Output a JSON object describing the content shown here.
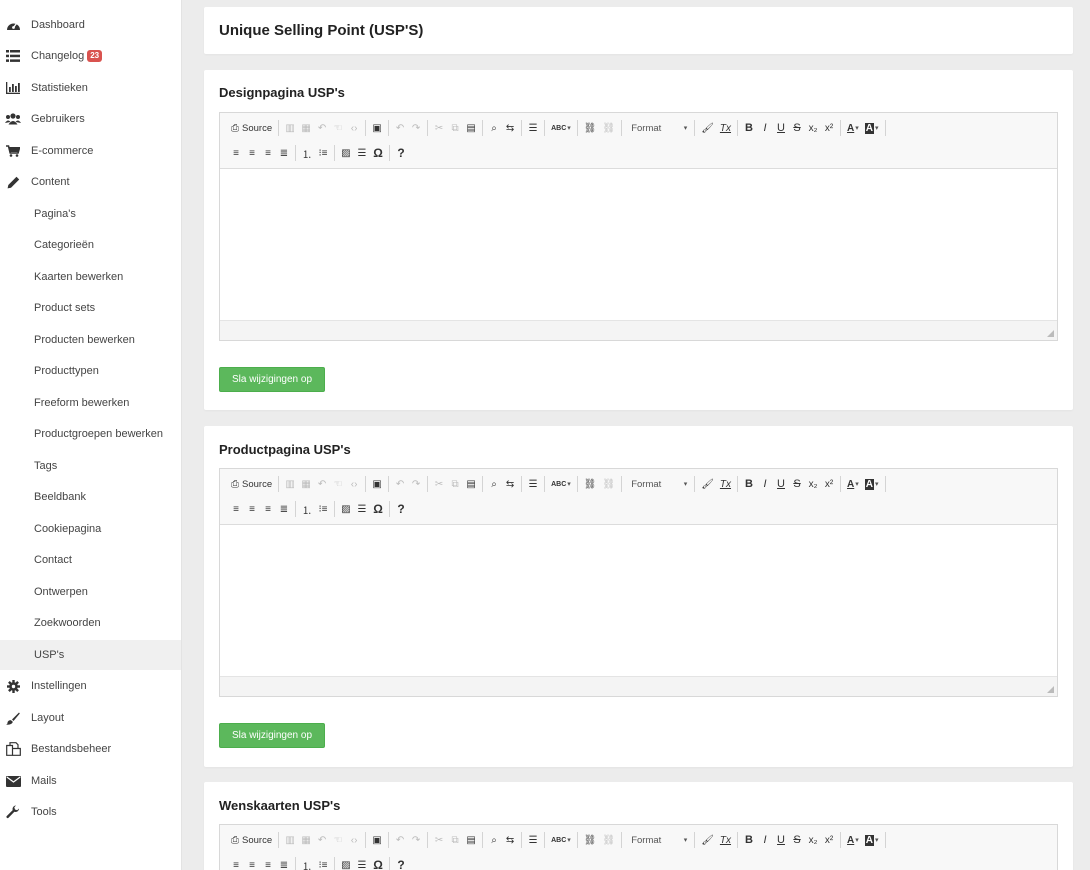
{
  "sidebar": {
    "items": [
      {
        "label": "Dashboard",
        "icon": "dashboard-icon"
      },
      {
        "label": "Changelog",
        "icon": "list-icon",
        "badge": "23"
      },
      {
        "label": "Statistieken",
        "icon": "bar-chart-icon"
      },
      {
        "label": "Gebruikers",
        "icon": "users-icon"
      },
      {
        "label": "E-commerce",
        "icon": "cart-icon"
      },
      {
        "label": "Content",
        "icon": "pencil-icon"
      },
      {
        "label": "Pagina's"
      },
      {
        "label": "Categorieën"
      },
      {
        "label": "Kaarten bewerken"
      },
      {
        "label": "Product sets"
      },
      {
        "label": "Producten bewerken"
      },
      {
        "label": "Producttypen"
      },
      {
        "label": "Freeform bewerken"
      },
      {
        "label": "Productgroepen bewerken"
      },
      {
        "label": "Tags"
      },
      {
        "label": "Beeldbank"
      },
      {
        "label": "Cookiepagina"
      },
      {
        "label": "Contact"
      },
      {
        "label": "Ontwerpen"
      },
      {
        "label": "Zoekwoorden"
      },
      {
        "label": "USP's",
        "active": true
      },
      {
        "label": "Instellingen",
        "icon": "gear-icon"
      },
      {
        "label": "Layout",
        "icon": "brush-icon"
      },
      {
        "label": "Bestandsbeheer",
        "icon": "files-icon"
      },
      {
        "label": "Mails",
        "icon": "envelope-icon"
      },
      {
        "label": "Tools",
        "icon": "wrench-icon"
      }
    ]
  },
  "page": {
    "title": "Unique Selling Point (USP'S)"
  },
  "sections": [
    {
      "title": "Designpagina USP's",
      "save_label": "Sla wijzigingen op"
    },
    {
      "title": "Productpagina USP's",
      "save_label": "Sla wijzigingen op"
    },
    {
      "title": "Wenskaarten USP's"
    }
  ],
  "editor": {
    "source_label": "Source",
    "format_label": "Format",
    "spellcheck_label": "ABC",
    "bold": "B",
    "italic": "I",
    "underline": "U",
    "strike": "S",
    "omega": "Ω",
    "help": "?"
  },
  "colors": {
    "save_button": "#5cb85c",
    "badge": "#d9534f",
    "background": "#ececec"
  }
}
